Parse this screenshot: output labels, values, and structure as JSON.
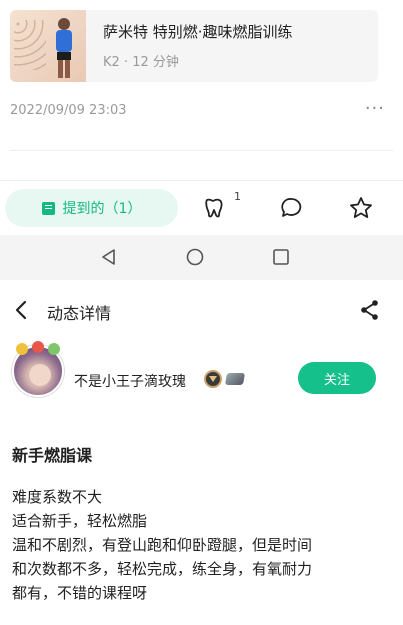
{
  "course": {
    "title": "萨米特 特别燃·趣味燃脂训练",
    "meta": "K2 · 12 分钟"
  },
  "post": {
    "timestamp": "2022/09/09 23:03",
    "more": "···"
  },
  "actions": {
    "mention_label": "提到的（1）",
    "like_count": "1"
  },
  "detail": {
    "header_title": "动态详情",
    "user_name": "不是小王子滴玫瑰",
    "follow_label": "关注",
    "title": "新手燃脂课",
    "lines": [
      "难度系数不大",
      "适合新手，轻松燃脂",
      "温和不剧烈，有登山跑和仰卧蹬腿，但是时间",
      "和次数都不多，轻松完成，练全身，有氧耐力",
      "都有，不错的课程呀"
    ]
  },
  "colors": {
    "accent": "#16c08a",
    "mention_bg": "#e6f8f1"
  }
}
